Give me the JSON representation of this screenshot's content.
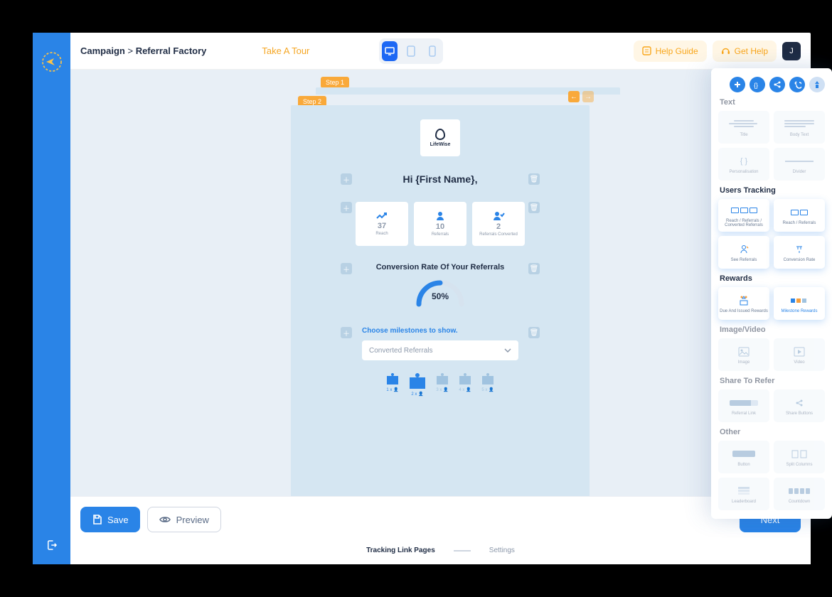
{
  "breadcrumb": {
    "a": "Campaign",
    "sep": ">",
    "b": "Referral Factory"
  },
  "take_tour": "Take A Tour",
  "help_guide": "Help Guide",
  "get_help": "Get Help",
  "avatar_letter": "J",
  "steps": {
    "step1": "Step 1",
    "step2": "Step 2"
  },
  "logo": "LifeWise",
  "greeting": "Hi {First Name},",
  "stats": {
    "reach": {
      "label": "Reach",
      "value": "37"
    },
    "referrals": {
      "label": "Referrals",
      "value": "10"
    },
    "converted": {
      "label": "Referrals Converted",
      "value": "2"
    }
  },
  "conversion": {
    "title": "Conversion Rate Of Your Referrals",
    "pct": "50%"
  },
  "milestones": {
    "title": "Choose milestones to show.",
    "select": "Converted Referrals",
    "items": [
      "1 x 👤",
      "2 x 👤",
      "3 x 👤",
      "4 x 👤",
      "5 x 👤"
    ]
  },
  "footer": {
    "save": "Save",
    "preview": "Preview",
    "next": "Next",
    "tab1": "Tracking Link Pages",
    "tab2": "Settings"
  },
  "rp": {
    "text": "Text",
    "text_items": {
      "title": "Title",
      "body": "Body Text",
      "pers": "Personalisation",
      "div": "Divider"
    },
    "ut": "Users Tracking",
    "ut_items": {
      "rrc": "Reach / Referrals / Converted Referrals",
      "rr": "Reach / Referrals",
      "see": "See Referrals",
      "cr": "Conversion Rate"
    },
    "rw": "Rewards",
    "rw_items": {
      "di": "Due And Issued Rewards",
      "ml": "Milestone Rewards"
    },
    "iv": "Image/Video",
    "iv_items": {
      "img": "Image",
      "vid": "Video"
    },
    "st": "Share To Refer",
    "st_items": {
      "rl": "Referral Link",
      "sb": "Share Buttons"
    },
    "ot": "Other",
    "ot_items": {
      "bt": "Button",
      "sc": "Split Columns",
      "lb": "Leaderboard",
      "cd": "Countdown"
    }
  }
}
